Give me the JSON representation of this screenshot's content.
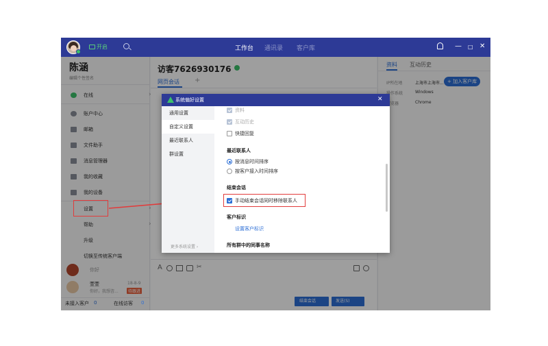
{
  "topbar": {
    "status": "开启",
    "nav": [
      "工作台",
      "通讯录",
      "客户库"
    ],
    "window_controls": [
      "—",
      "□",
      "✕"
    ]
  },
  "user": {
    "name": "陈涵",
    "signature": "编辑个性签名"
  },
  "menu": [
    {
      "label": "在线",
      "icon": "check-circle-icon",
      "arrow": true
    },
    {
      "label": "账户中心",
      "icon": "account-icon"
    },
    {
      "label": "邮箱",
      "icon": "mail-icon"
    },
    {
      "label": "文件助手",
      "icon": "folder-icon"
    },
    {
      "label": "消息管理器",
      "icon": "message-icon"
    },
    {
      "label": "我的收藏",
      "icon": "bookmark-icon"
    },
    {
      "label": "我的设备",
      "icon": "device-icon"
    },
    {
      "label": "设置",
      "arrow": true
    },
    {
      "label": "帮助",
      "arrow": true
    },
    {
      "label": "升级"
    },
    {
      "label": "切换至传统客户端"
    }
  ],
  "conversation": {
    "visitor_title": "访客7626930176",
    "tab": "网页会话",
    "tab_add": "+",
    "contacts": [
      {
        "name": "",
        "preview": "你好"
      },
      {
        "name": "萱萱",
        "preview": "你好，我想咨...",
        "date": "18-8-9",
        "badge": "待跟进"
      }
    ],
    "footer_unaccepted_label": "未接入客户",
    "footer_unaccepted_count": "0",
    "footer_online_label": "在线访客",
    "footer_online_count": "0",
    "end_button": "结束会话",
    "send_button": "发送(S)"
  },
  "right_panel": {
    "tabs": [
      "资料",
      "互动历史"
    ],
    "add_customer": "+ 加入客户库",
    "fields": [
      {
        "label": "IP所在地",
        "value": "上海市上海市..."
      },
      {
        "label": "操作系统",
        "value": "Windows"
      },
      {
        "label": "浏览器",
        "value": "Chrome"
      }
    ]
  },
  "dialog": {
    "title": "系统偏好设置",
    "close": "✕",
    "nav": [
      "通用设置",
      "自定义设置",
      "最近联系人",
      "群设置"
    ],
    "more": "更多系统设置 ›",
    "options_top": [
      {
        "label": "资料",
        "state": "disabled"
      },
      {
        "label": "互动历史",
        "state": "disabled"
      },
      {
        "label": "快捷回复",
        "state": "off"
      }
    ],
    "section_recent": "最近联系人",
    "radios": [
      {
        "label": "按消息时间排序",
        "checked": true
      },
      {
        "label": "按客户接入时间排序",
        "checked": false
      }
    ],
    "section_end": "结束会话",
    "end_option": "手动结束会话同时移除联系人",
    "section_tag": "客户标识",
    "tag_link": "设置客户标识",
    "section_colleague": "所有群中的同事名称"
  },
  "colors": {
    "brand": "#2d3a96",
    "accent": "#2d6fd6",
    "highlight": "#e23b3b"
  }
}
